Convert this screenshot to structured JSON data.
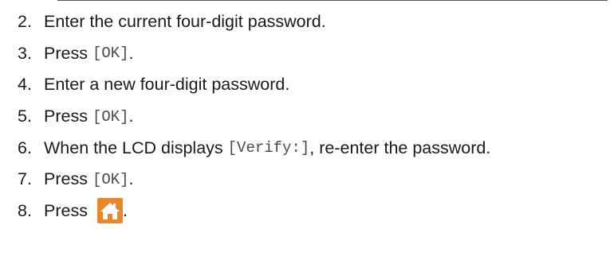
{
  "steps": [
    {
      "num": "2.",
      "text": "Enter the current four-digit password."
    },
    {
      "num": "3.",
      "prefix": "Press ",
      "code": "[OK]",
      "suffix": "."
    },
    {
      "num": "4.",
      "text": "Enter a new four-digit password."
    },
    {
      "num": "5.",
      "prefix": "Press ",
      "code": "[OK]",
      "suffix": "."
    },
    {
      "num": "6.",
      "prefix": "When the LCD displays ",
      "code": "[Verify:]",
      "suffix": ", re-enter the password."
    },
    {
      "num": "7.",
      "prefix": "Press ",
      "code": "[OK]",
      "suffix": "."
    },
    {
      "num": "8.",
      "prefix": "Press ",
      "icon": "home-icon",
      "suffix": "."
    }
  ],
  "colors": {
    "home_button": "#e8862a",
    "code_text": "#4a4a4a"
  }
}
